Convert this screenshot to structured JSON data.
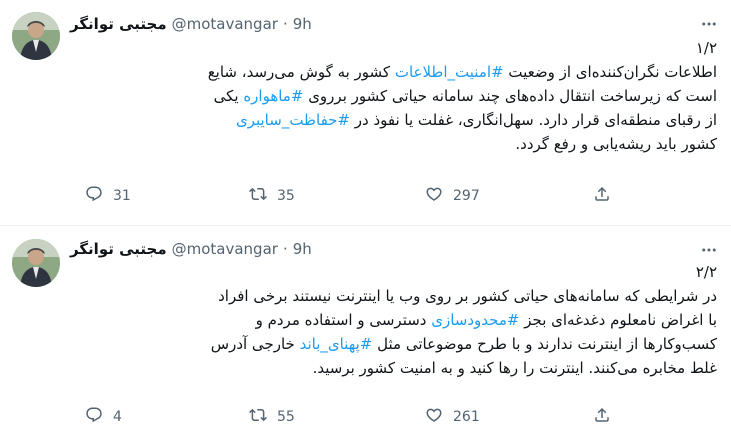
{
  "tweets": [
    {
      "author": {
        "display_name": "مجتبی توانگر",
        "handle": "@motavangar",
        "separator": "·",
        "time": "9h"
      },
      "body_lines": [
        [
          {
            "t": "۱/۲",
            "h": false
          }
        ],
        [
          {
            "t": "اطلاعات نگران‌کننده‌ای از وضعیت ",
            "h": false
          },
          {
            "t": "#امنیت_اطلاعات",
            "h": true
          },
          {
            "t": " کشور به گوش می‌رسد، شایع",
            "h": false
          }
        ],
        [
          {
            "t": "است که زیرساخت انتقال داده‌های چند سامانه حیاتی کشور برروی ",
            "h": false
          },
          {
            "t": "#ماهواره",
            "h": true
          },
          {
            "t": " یکی",
            "h": false
          }
        ],
        [
          {
            "t": "از رقبای منطقه‌ای قرار دارد. سهل‌انگاری، غفلت یا نفوذ در ",
            "h": false
          },
          {
            "t": "#حفاظت_سایبری",
            "h": true
          }
        ],
        [
          {
            "t": "کشور باید ریشه‌یابی و رفع گردد.",
            "h": false
          }
        ]
      ],
      "actions": {
        "replies": "31",
        "retweets": "35",
        "likes": "297"
      }
    },
    {
      "author": {
        "display_name": "مجتبی توانگر",
        "handle": "@motavangar",
        "separator": "·",
        "time": "9h"
      },
      "body_lines": [
        [
          {
            "t": "۲/۲",
            "h": false
          }
        ],
        [
          {
            "t": "در شرایطی که سامانه‌های حیاتی کشور بر روی وب یا اینترنت نیستند برخی افراد",
            "h": false
          }
        ],
        [
          {
            "t": "با اغراض نامعلوم دغدغه‌ای بجز ",
            "h": false
          },
          {
            "t": "#محدودسازی",
            "h": true
          },
          {
            "t": " دسترسی و استفاده مردم و",
            "h": false
          }
        ],
        [
          {
            "t": "کسب‌وکارها از اینترنت ندارند و با طرح موضوعاتی مثل ",
            "h": false
          },
          {
            "t": "#پهنای_باند",
            "h": true
          },
          {
            "t": " خارجی آدرس",
            "h": false
          }
        ],
        [
          {
            "t": "غلط مخابره می‌کنند. اینترنت را رها کنید و به امنیت کشور برسید.",
            "h": false
          }
        ]
      ],
      "actions": {
        "replies": "4",
        "retweets": "55",
        "likes": "261"
      }
    }
  ],
  "icons": {
    "avatar": "avatar-photo",
    "more": "more-options-icon",
    "reply": "reply-icon",
    "retweet": "retweet-icon",
    "like": "like-heart-icon",
    "share": "share-icon"
  },
  "colors": {
    "hashtag": "#1d9bf0",
    "secondary_text": "#536471",
    "primary_text": "#0f1419"
  }
}
